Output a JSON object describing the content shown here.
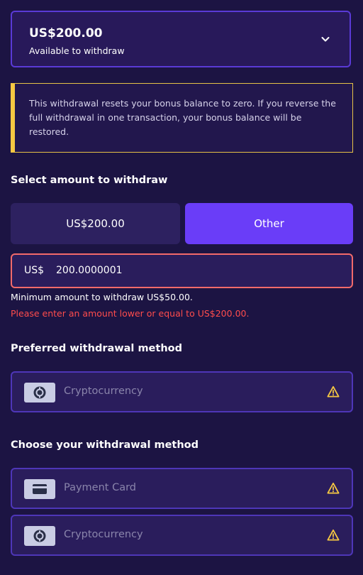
{
  "balance": {
    "amount": "US$200.00",
    "subtitle": "Available to withdraw"
  },
  "warning": {
    "text": "This withdrawal resets your bonus balance to zero. If you reverse the full withdrawal in one transaction, your bonus balance will be restored."
  },
  "amount_section": {
    "title": "Select amount to withdraw",
    "options": [
      "US$200.00",
      "Other"
    ],
    "selected": "Other",
    "input": {
      "currency": "US$",
      "value": "200.0000001"
    },
    "helper": "Minimum amount to withdraw US$50.00.",
    "error": "Please enter an amount lower or equal to US$200.00."
  },
  "preferred_section": {
    "title": "Preferred withdrawal method",
    "methods": [
      {
        "label": "Cryptocurrency",
        "icon": "crypto-coin-icon"
      }
    ]
  },
  "choose_section": {
    "title": "Choose your withdrawal method",
    "methods": [
      {
        "label": "Payment Card",
        "icon": "credit-card-icon"
      },
      {
        "label": "Cryptocurrency",
        "icon": "crypto-coin-icon"
      }
    ]
  },
  "colors": {
    "background": "#1c1443",
    "accent": "#6a3df8",
    "warning": "#f6c842",
    "error": "#ff4c4c"
  }
}
